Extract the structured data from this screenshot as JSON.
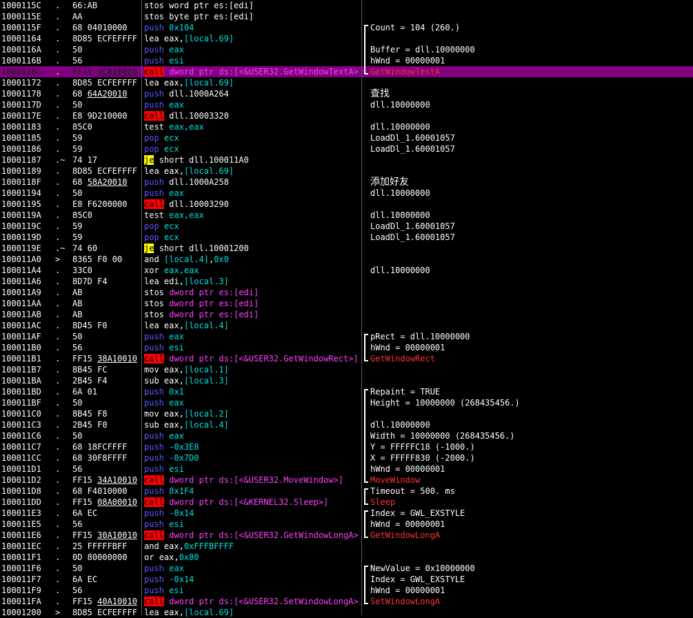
{
  "colors": {
    "background": "#000000",
    "highlight": "#800080",
    "call_bg": "#ff0000",
    "jump_bg": "#ffff00",
    "push_pop": "#5a5aff",
    "memory": "#ff40ff",
    "constant": "#00e0e0",
    "api_comment": "#ff3333"
  },
  "rows": [
    {
      "addr": "1000115C",
      "mark": ".",
      "hex": "66:AB",
      "mn": "stos",
      "ops": [
        {
          "t": "word ptr es:[edi]",
          "c": "w"
        }
      ],
      "cmt": ""
    },
    {
      "addr": "1000115E",
      "mark": ".",
      "hex": "AA",
      "mn": "stos",
      "ops": [
        {
          "t": "byte ptr es:[edi]",
          "c": "w"
        }
      ],
      "cmt": ""
    },
    {
      "addr": "1000115F",
      "mark": ".",
      "hex": "68 04010000",
      "mn": "push",
      "ops": [
        {
          "t": "0x104",
          "c": "c"
        }
      ],
      "cmt": "Count = 104 (260.)"
    },
    {
      "addr": "10001164",
      "mark": ".",
      "hex": "8D85 ECFEFFFF",
      "mn": "lea",
      "ops": [
        {
          "t": "eax,",
          "c": "w"
        },
        {
          "t": "[local.69]",
          "c": "c"
        }
      ],
      "cmt": ""
    },
    {
      "addr": "1000116A",
      "mark": ".",
      "hex": "50",
      "mn": "push",
      "ops": [
        {
          "t": "eax",
          "c": "c"
        }
      ],
      "cmt": "Buffer = dll.10000000"
    },
    {
      "addr": "1000116B",
      "mark": ".",
      "hex": "56",
      "mn": "push",
      "ops": [
        {
          "t": "esi",
          "c": "c"
        }
      ],
      "cmt": "hWnd = 00000001"
    },
    {
      "addr": "1000116C",
      "mark": ".",
      "hex": "FF15 3CA10010",
      "hexu": "3CA10010",
      "mn": "call",
      "ops": [
        {
          "t": "dword ptr ds:[<&USER32.GetWindowTextA>]",
          "c": "m"
        }
      ],
      "cmt": "GetWindowTextA",
      "hl": true
    },
    {
      "addr": "10001172",
      "mark": ".",
      "hex": "8D85 ECFEFFFF",
      "mn": "lea",
      "ops": [
        {
          "t": "eax,",
          "c": "w"
        },
        {
          "t": "[local.69]",
          "c": "c"
        }
      ],
      "cmt": ""
    },
    {
      "addr": "10001178",
      "mark": ".",
      "hex": "68 64A20010",
      "hexu": "64A20010",
      "mn": "push",
      "ops": [
        {
          "t": "dll.1000A264",
          "c": "w"
        }
      ],
      "cmt": "查找",
      "cjk": true
    },
    {
      "addr": "1000117D",
      "mark": ".",
      "hex": "50",
      "mn": "push",
      "ops": [
        {
          "t": "eax",
          "c": "c"
        }
      ],
      "cmt": "dll.10000000"
    },
    {
      "addr": "1000117E",
      "mark": ".",
      "hex": "E8 9D210000",
      "mn": "call",
      "ops": [
        {
          "t": "dll.10003320",
          "c": "w"
        }
      ],
      "cmt": ""
    },
    {
      "addr": "10001183",
      "mark": ".",
      "hex": "85C0",
      "mn": "test",
      "ops": [
        {
          "t": "eax,eax",
          "c": "c"
        }
      ],
      "cmt": "dll.10000000"
    },
    {
      "addr": "10001185",
      "mark": ".",
      "hex": "59",
      "mn": "pop",
      "ops": [
        {
          "t": "ecx",
          "c": "c"
        }
      ],
      "cmt": "LoadDl_1.60001057"
    },
    {
      "addr": "10001186",
      "mark": ".",
      "hex": "59",
      "mn": "pop",
      "ops": [
        {
          "t": "ecx",
          "c": "c"
        }
      ],
      "cmt": "LoadDl_1.60001057"
    },
    {
      "addr": "10001187",
      "mark": ".~",
      "hex": "74 17",
      "mn": "je",
      "ops": [
        {
          "t": "short dll.100011A0",
          "c": "w"
        }
      ],
      "cmt": ""
    },
    {
      "addr": "10001189",
      "mark": ".",
      "hex": "8D85 ECFEFFFF",
      "mn": "lea",
      "ops": [
        {
          "t": "eax,",
          "c": "w"
        },
        {
          "t": "[local.69]",
          "c": "c"
        }
      ],
      "cmt": ""
    },
    {
      "addr": "1000118F",
      "mark": ".",
      "hex": "68 58A20010",
      "hexu": "58A20010",
      "mn": "push",
      "ops": [
        {
          "t": "dll.1000A258",
          "c": "w"
        }
      ],
      "cmt": "添加好友",
      "cjk": true
    },
    {
      "addr": "10001194",
      "mark": ".",
      "hex": "50",
      "mn": "push",
      "ops": [
        {
          "t": "eax",
          "c": "c"
        }
      ],
      "cmt": "dll.10000000"
    },
    {
      "addr": "10001195",
      "mark": ".",
      "hex": "E8 F6200000",
      "mn": "call",
      "ops": [
        {
          "t": "dll.10003290",
          "c": "w"
        }
      ],
      "cmt": ""
    },
    {
      "addr": "1000119A",
      "mark": ".",
      "hex": "85C0",
      "mn": "test",
      "ops": [
        {
          "t": "eax,eax",
          "c": "c"
        }
      ],
      "cmt": "dll.10000000"
    },
    {
      "addr": "1000119C",
      "mark": ".",
      "hex": "59",
      "mn": "pop",
      "ops": [
        {
          "t": "ecx",
          "c": "c"
        }
      ],
      "cmt": "LoadDl_1.60001057"
    },
    {
      "addr": "1000119D",
      "mark": ".",
      "hex": "59",
      "mn": "pop",
      "ops": [
        {
          "t": "ecx",
          "c": "c"
        }
      ],
      "cmt": "LoadDl_1.60001057"
    },
    {
      "addr": "1000119E",
      "mark": ".~",
      "hex": "74 60",
      "mn": "je",
      "ops": [
        {
          "t": "short dll.10001200",
          "c": "w"
        }
      ],
      "cmt": ""
    },
    {
      "addr": "100011A0",
      "mark": ">",
      "hex": "8365 F0 00",
      "mn": "and",
      "ops": [
        {
          "t": "[local.4]",
          "c": "c"
        },
        {
          "t": ",",
          "c": "w"
        },
        {
          "t": "0x0",
          "c": "c"
        }
      ],
      "cmt": ""
    },
    {
      "addr": "100011A4",
      "mark": ".",
      "hex": "33C0",
      "mn": "xor",
      "ops": [
        {
          "t": "eax,eax",
          "c": "c"
        }
      ],
      "cmt": "dll.10000000"
    },
    {
      "addr": "100011A6",
      "mark": ".",
      "hex": "8D7D F4",
      "mn": "lea",
      "ops": [
        {
          "t": "edi,",
          "c": "w"
        },
        {
          "t": "[local.3]",
          "c": "c"
        }
      ],
      "cmt": ""
    },
    {
      "addr": "100011A9",
      "mark": ".",
      "hex": "AB",
      "mn": "stos",
      "ops": [
        {
          "t": "dword ptr es:[edi]",
          "c": "m"
        }
      ],
      "cmt": ""
    },
    {
      "addr": "100011AA",
      "mark": ".",
      "hex": "AB",
      "mn": "stos",
      "ops": [
        {
          "t": "dword ptr es:[edi]",
          "c": "m"
        }
      ],
      "cmt": ""
    },
    {
      "addr": "100011AB",
      "mark": ".",
      "hex": "AB",
      "mn": "stos",
      "ops": [
        {
          "t": "dword ptr es:[edi]",
          "c": "m"
        }
      ],
      "cmt": ""
    },
    {
      "addr": "100011AC",
      "mark": ".",
      "hex": "8D45 F0",
      "mn": "lea",
      "ops": [
        {
          "t": "eax,",
          "c": "w"
        },
        {
          "t": "[local.4]",
          "c": "c"
        }
      ],
      "cmt": ""
    },
    {
      "addr": "100011AF",
      "mark": ".",
      "hex": "50",
      "mn": "push",
      "ops": [
        {
          "t": "eax",
          "c": "c"
        }
      ],
      "cmt": "pRect = dll.10000000"
    },
    {
      "addr": "100011B0",
      "mark": ".",
      "hex": "56",
      "mn": "push",
      "ops": [
        {
          "t": "esi",
          "c": "c"
        }
      ],
      "cmt": "hWnd = 00000001"
    },
    {
      "addr": "100011B1",
      "mark": ".",
      "hex": "FF15 38A10010",
      "hexu": "38A10010",
      "mn": "call",
      "ops": [
        {
          "t": "dword ptr ds:[<&USER32.GetWindowRect>]",
          "c": "m"
        }
      ],
      "cmt": "GetWindowRect",
      "red": true
    },
    {
      "addr": "100011B7",
      "mark": ".",
      "hex": "8B45 FC",
      "mn": "mov",
      "ops": [
        {
          "t": "eax,",
          "c": "w"
        },
        {
          "t": "[local.1]",
          "c": "c"
        }
      ],
      "cmt": ""
    },
    {
      "addr": "100011BA",
      "mark": ".",
      "hex": "2B45 F4",
      "mn": "sub",
      "ops": [
        {
          "t": "eax,",
          "c": "w"
        },
        {
          "t": "[local.3]",
          "c": "c"
        }
      ],
      "cmt": ""
    },
    {
      "addr": "100011BD",
      "mark": ".",
      "hex": "6A 01",
      "mn": "push",
      "ops": [
        {
          "t": "0x1",
          "c": "c"
        }
      ],
      "cmt": "Repaint = TRUE"
    },
    {
      "addr": "100011BF",
      "mark": ".",
      "hex": "50",
      "mn": "push",
      "ops": [
        {
          "t": "eax",
          "c": "c"
        }
      ],
      "cmt": "Height = 10000000 (268435456.)"
    },
    {
      "addr": "100011C0",
      "mark": ".",
      "hex": "8B45 F8",
      "mn": "mov",
      "ops": [
        {
          "t": "eax,",
          "c": "w"
        },
        {
          "t": "[local.2]",
          "c": "c"
        }
      ],
      "cmt": ""
    },
    {
      "addr": "100011C3",
      "mark": ".",
      "hex": "2B45 F0",
      "mn": "sub",
      "ops": [
        {
          "t": "eax,",
          "c": "w"
        },
        {
          "t": "[local.4]",
          "c": "c"
        }
      ],
      "cmt": "dll.10000000"
    },
    {
      "addr": "100011C6",
      "mark": ".",
      "hex": "50",
      "mn": "push",
      "ops": [
        {
          "t": "eax",
          "c": "c"
        }
      ],
      "cmt": "Width = 10000000 (268435456.)"
    },
    {
      "addr": "100011C7",
      "mark": ".",
      "hex": "68 18FCFFFF",
      "mn": "push",
      "ops": [
        {
          "t": "-0x3E8",
          "c": "c"
        }
      ],
      "cmt": "Y = FFFFFC18 (-1000.)"
    },
    {
      "addr": "100011CC",
      "mark": ".",
      "hex": "68 30F8FFFF",
      "mn": "push",
      "ops": [
        {
          "t": "-0x7D0",
          "c": "c"
        }
      ],
      "cmt": "X = FFFFF830 (-2000.)"
    },
    {
      "addr": "100011D1",
      "mark": ".",
      "hex": "56",
      "mn": "push",
      "ops": [
        {
          "t": "esi",
          "c": "c"
        }
      ],
      "cmt": "hWnd = 00000001"
    },
    {
      "addr": "100011D2",
      "mark": ".",
      "hex": "FF15 34A10010",
      "hexu": "34A10010",
      "mn": "call",
      "ops": [
        {
          "t": "dword ptr ds:[<&USER32.MoveWindow>]",
          "c": "m"
        }
      ],
      "cmt": "MoveWindow",
      "red": true
    },
    {
      "addr": "100011D8",
      "mark": ".",
      "hex": "68 F4010000",
      "mn": "push",
      "ops": [
        {
          "t": "0x1F4",
          "c": "c"
        }
      ],
      "cmt": "Timeout = 500. ms"
    },
    {
      "addr": "100011DD",
      "mark": ".",
      "hex": "FF15 08A00010",
      "hexu": "08A00010",
      "mn": "call",
      "ops": [
        {
          "t": "dword ptr ds:[<&KERNEL32.Sleep>]",
          "c": "m"
        }
      ],
      "cmt": "Sleep",
      "red": true
    },
    {
      "addr": "100011E3",
      "mark": ".",
      "hex": "6A EC",
      "mn": "push",
      "ops": [
        {
          "t": "-0x14",
          "c": "c"
        }
      ],
      "cmt": "Index = GWL_EXSTYLE"
    },
    {
      "addr": "100011E5",
      "mark": ".",
      "hex": "56",
      "mn": "push",
      "ops": [
        {
          "t": "esi",
          "c": "c"
        }
      ],
      "cmt": "hWnd = 00000001"
    },
    {
      "addr": "100011E6",
      "mark": ".",
      "hex": "FF15 30A10010",
      "hexu": "30A10010",
      "mn": "call",
      "ops": [
        {
          "t": "dword ptr ds:[<&USER32.GetWindowLongA>]",
          "c": "m"
        }
      ],
      "cmt": "GetWindowLongA",
      "red": true
    },
    {
      "addr": "100011EC",
      "mark": ".",
      "hex": "25 FFFFFBFF",
      "mn": "and",
      "ops": [
        {
          "t": "eax,",
          "c": "w"
        },
        {
          "t": "0xFFFBFFFF",
          "c": "c"
        }
      ],
      "cmt": ""
    },
    {
      "addr": "100011F1",
      "mark": ".",
      "hex": "0D 80000000",
      "mn": "or",
      "ops": [
        {
          "t": "eax,",
          "c": "w"
        },
        {
          "t": "0x80",
          "c": "c"
        }
      ],
      "cmt": ""
    },
    {
      "addr": "100011F6",
      "mark": ".",
      "hex": "50",
      "mn": "push",
      "ops": [
        {
          "t": "eax",
          "c": "c"
        }
      ],
      "cmt": "NewValue = 0x10000000"
    },
    {
      "addr": "100011F7",
      "mark": ".",
      "hex": "6A EC",
      "mn": "push",
      "ops": [
        {
          "t": "-0x14",
          "c": "c"
        }
      ],
      "cmt": "Index = GWL_EXSTYLE"
    },
    {
      "addr": "100011F9",
      "mark": ".",
      "hex": "56",
      "mn": "push",
      "ops": [
        {
          "t": "esi",
          "c": "c"
        }
      ],
      "cmt": "hWnd = 00000001"
    },
    {
      "addr": "100011FA",
      "mark": ".",
      "hex": "FF15 40A10010",
      "hexu": "40A10010",
      "mn": "call",
      "ops": [
        {
          "t": "dword ptr ds:[<&USER32.SetWindowLongA>]",
          "c": "m"
        }
      ],
      "cmt": "SetWindowLongA",
      "red": true
    },
    {
      "addr": "10001200",
      "mark": ">",
      "hex": "8D85 ECFEFFFF",
      "mn": "lea",
      "ops": [
        {
          "t": "eax,",
          "c": "w"
        },
        {
          "t": "[local.69]",
          "c": "c"
        }
      ],
      "cmt": ""
    }
  ],
  "call_groups": [
    {
      "from": 2,
      "to": 6
    },
    {
      "from": 30,
      "to": 32
    },
    {
      "from": 35,
      "to": 43
    },
    {
      "from": 44,
      "to": 45
    },
    {
      "from": 46,
      "to": 48
    },
    {
      "from": 51,
      "to": 54
    }
  ]
}
